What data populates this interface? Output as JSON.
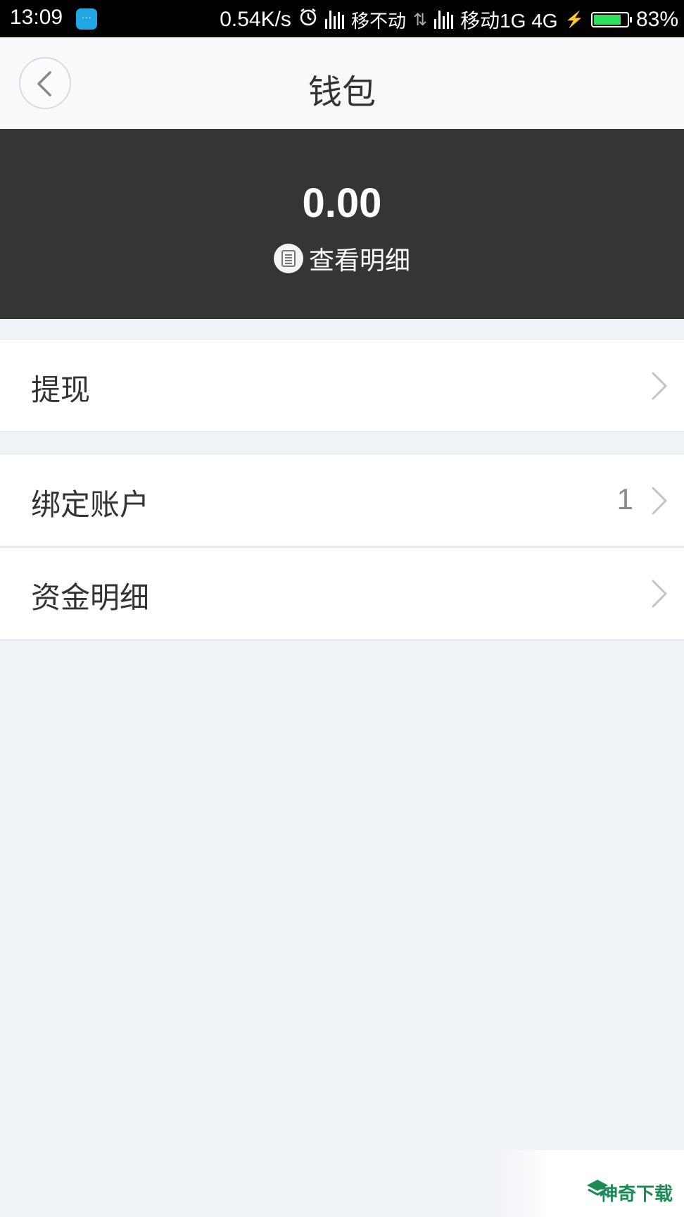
{
  "status_bar": {
    "time": "13:09",
    "net_speed": "0.54K/s",
    "carrier1": "移不动",
    "carrier2": "移动1G 4G",
    "battery": "83%",
    "battery_level": 0.83
  },
  "nav": {
    "title": "钱包"
  },
  "balance": {
    "amount": "0.00",
    "detail_link": "查看明细"
  },
  "menu": {
    "withdraw": {
      "label": "提现"
    },
    "bound_accounts": {
      "label": "绑定账户",
      "count": "1"
    },
    "fund_details": {
      "label": "资金明细"
    }
  },
  "watermark": {
    "text": "神奇下载"
  },
  "colors": {
    "banner_bg": "#353535",
    "page_bg": "#eff2f6",
    "battery_fill": "#2ee05a"
  }
}
